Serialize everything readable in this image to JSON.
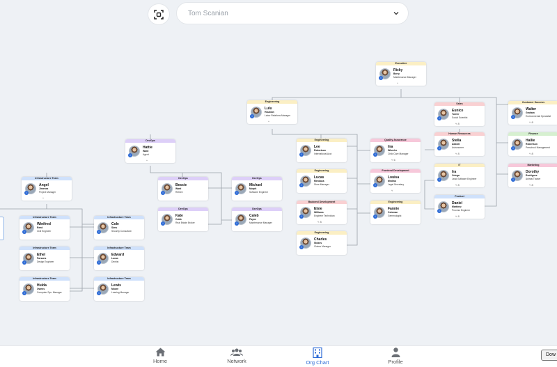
{
  "search": {
    "value": "Tom Scanian"
  },
  "nav": [
    {
      "label": "Home",
      "icon": "home-icon",
      "active": false
    },
    {
      "label": "Network",
      "icon": "network-icon",
      "active": false
    },
    {
      "label": "Org Chart",
      "icon": "org-chart-icon",
      "active": true
    },
    {
      "label": "Profile",
      "icon": "profile-icon",
      "active": false
    }
  ],
  "download_label": "Dow",
  "employees": [
    {
      "dept": "Executive",
      "color": "yellow",
      "first": "Ricky",
      "last": "Berry",
      "role": "Maintenance Manager",
      "toggle": "^"
    },
    {
      "dept": "Engineering",
      "color": "yellow",
      "first": "Lulu",
      "last": "Houston",
      "role": "Labor Relations Manager",
      "toggle": "^"
    },
    {
      "dept": "DevOps",
      "color": "purple",
      "first": "Hattie",
      "last": "Ward",
      "role": "Agent",
      "toggle": "^"
    },
    {
      "dept": "Infrastructure Team",
      "color": "blue",
      "first": "Angel",
      "last": "Jimenez",
      "role": "Project Manager",
      "toggle": "^"
    },
    {
      "dept": "Infrastructure Team",
      "color": "blue",
      "first": "Winifred",
      "last": "Reed",
      "role": "Civil Engineer",
      "toggle": ""
    },
    {
      "dept": "Infrastructure Team",
      "color": "blue",
      "first": "Cole",
      "last": "Sims",
      "role": "Security Consultant",
      "toggle": ""
    },
    {
      "dept": "Infrastructure Team",
      "color": "blue",
      "first": "Ethel",
      "last": "Parsons",
      "role": "Design Engineer",
      "toggle": ""
    },
    {
      "dept": "Infrastructure Team",
      "color": "blue",
      "first": "Edward",
      "last": "Lucas",
      "role": "Dentist",
      "toggle": ""
    },
    {
      "dept": "Infrastructure Team",
      "color": "blue",
      "first": "Hulda",
      "last": "Owens",
      "role": "Computer Sys. Manager",
      "toggle": ""
    },
    {
      "dept": "Infrastructure Team",
      "color": "blue",
      "first": "Lewis",
      "last": "Moore",
      "role": "Leasing Manager",
      "toggle": ""
    },
    {
      "dept": "DevOps",
      "color": "purple",
      "first": "Bessie",
      "last": "Ward",
      "role": "Retiree",
      "toggle": ""
    },
    {
      "dept": "DevOps",
      "color": "purple",
      "first": "Michael",
      "last": "Murph",
      "role": "Software Engineer",
      "toggle": ""
    },
    {
      "dept": "DevOps",
      "color": "purple",
      "first": "Kate",
      "last": "Cobb",
      "role": "Real Estate Broker",
      "toggle": ""
    },
    {
      "dept": "DevOps",
      "color": "purple",
      "first": "Caleb",
      "last": "Payne",
      "role": "Maintenance Manager",
      "toggle": ""
    },
    {
      "dept": "Engineering",
      "color": "yellow",
      "first": "Lee",
      "last": "Robertson",
      "role": "International Acct",
      "toggle": ""
    },
    {
      "dept": "Quality Assurance",
      "color": "pink",
      "first": "Ina",
      "last": "Wheeler",
      "role": "Child Care Manager",
      "toggle": "˅ 6"
    },
    {
      "dept": "Engineering",
      "color": "yellow",
      "first": "Lucas",
      "last": "Mendoza",
      "role": "Store Manager",
      "toggle": ""
    },
    {
      "dept": "Frontend Development",
      "color": "pink",
      "first": "Louisa",
      "last": "Medina",
      "role": "Legal Secretary",
      "toggle": "˅"
    },
    {
      "dept": "Backend Development",
      "color": "red",
      "first": "Elsie",
      "last": "Williams",
      "role": "Engineer Technician",
      "toggle": "˅ 8"
    },
    {
      "dept": "Engineering",
      "color": "yellow",
      "first": "Fannie",
      "last": "Coleman",
      "role": "Gemmologist",
      "toggle": ""
    },
    {
      "dept": "Engineering",
      "color": "yellow",
      "first": "Charles",
      "last": "Stokes",
      "role": "Claims Manager",
      "toggle": ""
    },
    {
      "dept": "Sales",
      "color": "red",
      "first": "Eunice",
      "last": "Turner",
      "role": "Social Scientist",
      "toggle": "˅ 8"
    },
    {
      "dept": "Human Resources",
      "color": "red",
      "first": "Stella",
      "last": "Abbott",
      "role": "Astronomer",
      "toggle": "˅ 8"
    },
    {
      "dept": "IT",
      "color": "yellow",
      "first": "Ira",
      "last": "Ortega",
      "role": "Lead Software Engineer",
      "toggle": "˅ 8"
    },
    {
      "dept": "Product",
      "color": "blue",
      "first": "Daniel",
      "last": "Martinez",
      "role": "Process Engineer",
      "toggle": "˅ 8"
    },
    {
      "dept": "Customer Success",
      "color": "yellow",
      "first": "Walter",
      "last": "Graham",
      "role": "Environmental Specialist",
      "toggle": "˅ 8"
    },
    {
      "dept": "Finance",
      "color": "green",
      "first": "Hallie",
      "last": "Robertson",
      "role": "Preschool Management",
      "toggle": "˅ 8"
    },
    {
      "dept": "Marketing",
      "color": "pink",
      "first": "Dorothy",
      "last": "Rodriguez",
      "role": "Animal Trainer",
      "toggle": "˅ 8"
    }
  ]
}
